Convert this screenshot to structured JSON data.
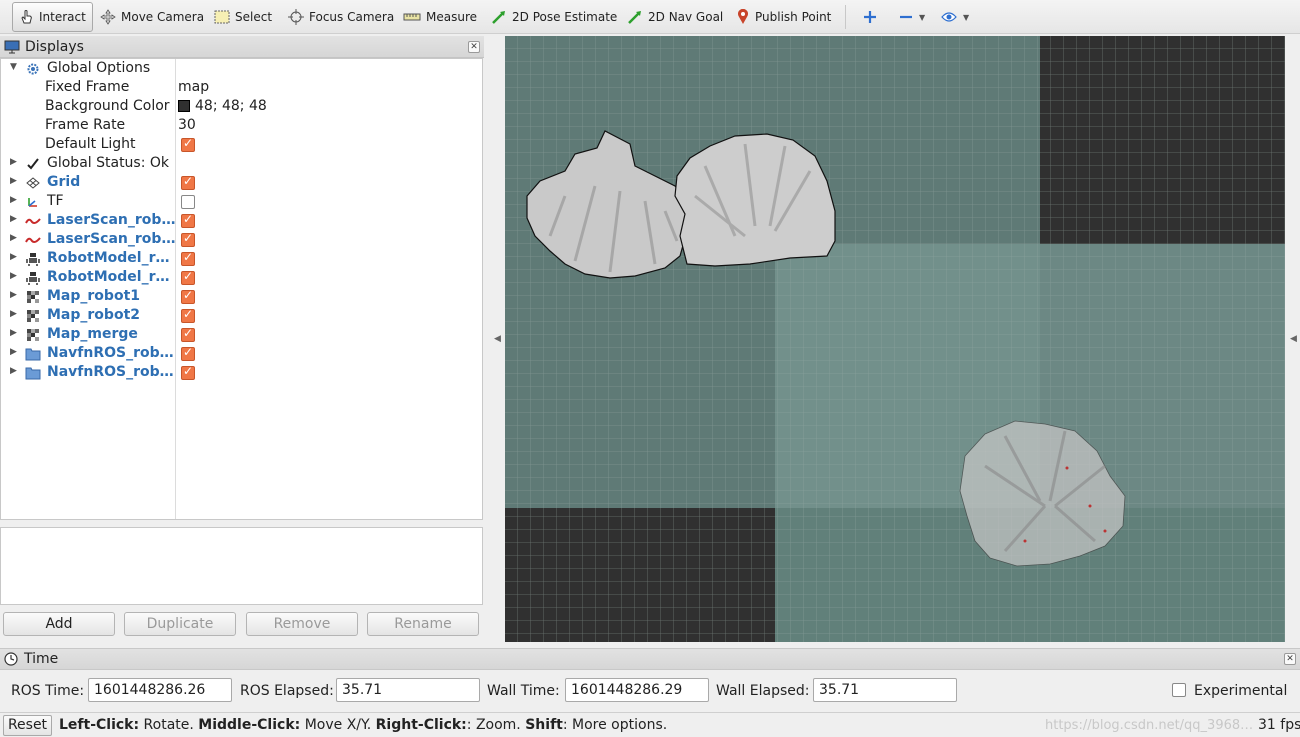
{
  "toolbar": {
    "interact": "Interact",
    "move_camera": "Move Camera",
    "select": "Select",
    "focus_camera": "Focus Camera",
    "measure": "Measure",
    "pose_estimate": "2D Pose Estimate",
    "nav_goal": "2D Nav Goal",
    "publish_point": "Publish Point"
  },
  "displays": {
    "title": "Displays",
    "global_options": "Global Options",
    "fixed_frame_label": "Fixed Frame",
    "fixed_frame_value": "map",
    "bg_color_label": "Background Color",
    "bg_color_value": "48; 48; 48",
    "frame_rate_label": "Frame Rate",
    "frame_rate_value": "30",
    "default_light_label": "Default Light",
    "global_status": "Global Status: Ok",
    "items": [
      {
        "label": "Grid",
        "icon": "grid-icon",
        "enabled": true
      },
      {
        "label": "TF",
        "icon": "tf-icon",
        "enabled": false
      },
      {
        "label": "LaserScan_rob…",
        "icon": "laserscan-icon",
        "enabled": true
      },
      {
        "label": "LaserScan_rob…",
        "icon": "laserscan-icon",
        "enabled": true
      },
      {
        "label": "RobotModel_r…",
        "icon": "robotmodel-icon",
        "enabled": true
      },
      {
        "label": "RobotModel_r…",
        "icon": "robotmodel-icon",
        "enabled": true
      },
      {
        "label": "Map_robot1",
        "icon": "map-icon",
        "enabled": true
      },
      {
        "label": "Map_robot2",
        "icon": "map-icon",
        "enabled": true
      },
      {
        "label": "Map_merge",
        "icon": "map-icon",
        "enabled": true
      },
      {
        "label": "NavfnROS_rob…",
        "icon": "folder-icon",
        "enabled": true
      },
      {
        "label": "NavfnROS_rob…",
        "icon": "folder-icon",
        "enabled": true
      }
    ],
    "buttons": {
      "add": "Add",
      "duplicate": "Duplicate",
      "remove": "Remove",
      "rename": "Rename"
    }
  },
  "time": {
    "title": "Time",
    "ros_time_label": "ROS Time:",
    "ros_time": "1601448286.26",
    "ros_elapsed_label": "ROS Elapsed:",
    "ros_elapsed": "35.71",
    "wall_time_label": "Wall Time:",
    "wall_time": "1601448286.29",
    "wall_elapsed_label": "Wall Elapsed:",
    "wall_elapsed": "35.71",
    "experimental": "Experimental"
  },
  "status": {
    "reset": "Reset",
    "hint_left": "Left-Click:",
    "hint_left_action": " Rotate. ",
    "hint_middle": "Middle-Click:",
    "hint_middle_action": " Move X/Y. ",
    "hint_right": "Right-Click:",
    "hint_right_action": ": Zoom. ",
    "hint_shift": "Shift",
    "hint_shift_action": ": More options.",
    "watermark": "https://blog.csdn.net/qq_3968…",
    "fps": "31 fps"
  },
  "colors": {
    "background": "#303030",
    "checkbox_on": "#f07746",
    "display_blue": "#2e6fb3"
  }
}
